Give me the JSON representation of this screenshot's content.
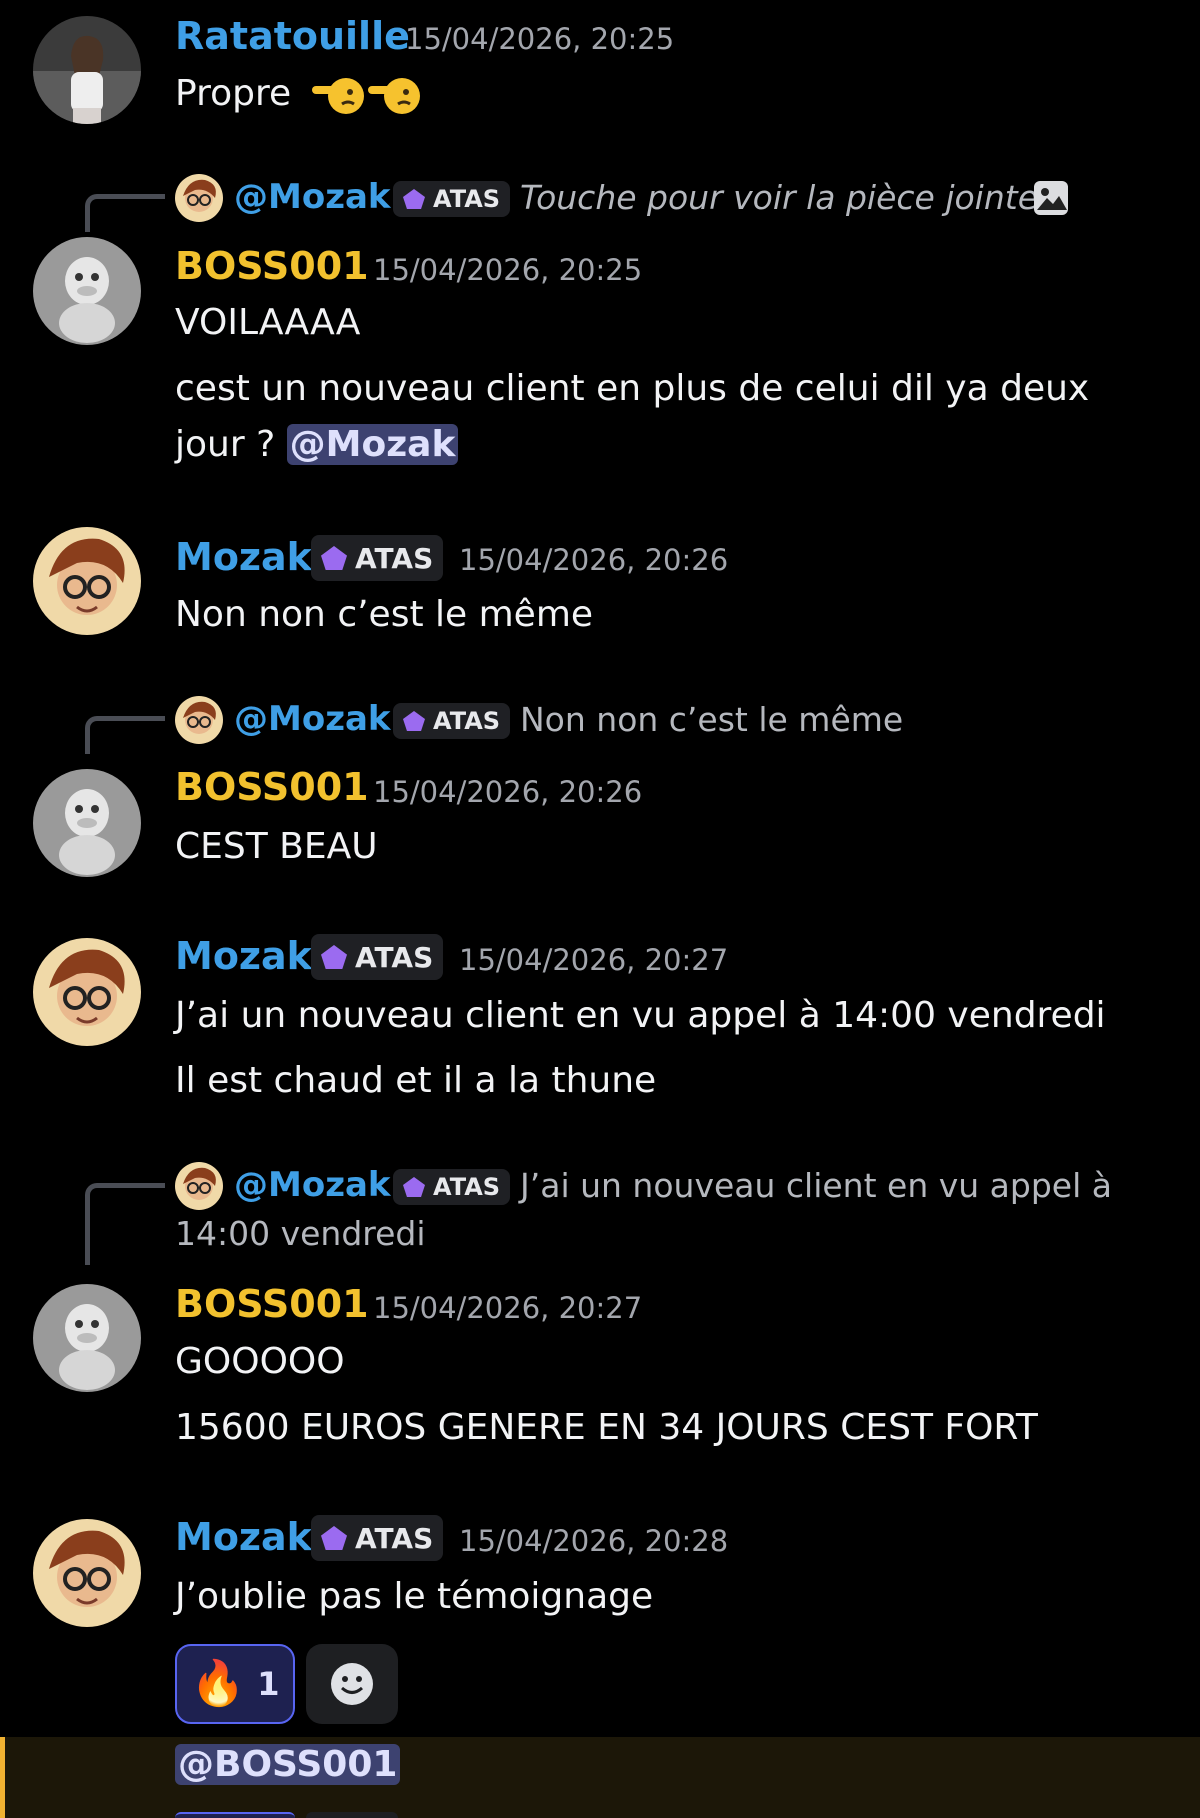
{
  "colors": {
    "background": "#000000",
    "username_blue": "#3f9fe6",
    "username_yellow": "#f2c12e",
    "timestamp": "#a3a6ad",
    "role_gem": "#9b6bf0",
    "mention_bg": "#3d4270",
    "highlight_bar": "#f0b232"
  },
  "messages": [
    {
      "author": "Ratatouille",
      "timestamp": "15/04/2026, 20:25",
      "lines": [
        "Propre"
      ],
      "emoji_icons": [
        "pointing-hand-emoji",
        "pointing-hand-emoji"
      ]
    },
    {
      "reply": {
        "name": "@Mozak",
        "role": "ATAS",
        "text": "Touche pour voir la pièce jointe",
        "icon": "image-icon"
      },
      "author": "BOSS001",
      "timestamp": "15/04/2026, 20:25",
      "lines": [
        "VOILAAAA",
        "cest un nouveau client en plus de celui dil ya deux",
        "jour ? "
      ],
      "mention": "@Mozak"
    },
    {
      "author": "Mozak",
      "role": "ATAS",
      "timestamp": "15/04/2026, 20:26",
      "lines": [
        "Non non c’est le même"
      ]
    },
    {
      "reply": {
        "name": "@Mozak",
        "role": "ATAS",
        "text": "Non non c’est le même"
      },
      "author": "BOSS001",
      "timestamp": "15/04/2026, 20:26",
      "lines": [
        "CEST BEAU"
      ]
    },
    {
      "author": "Mozak",
      "role": "ATAS",
      "timestamp": "15/04/2026, 20:27",
      "lines": [
        "J’ai un nouveau client en vu appel à 14:00 vendredi",
        "Il est chaud et il a la thune"
      ]
    },
    {
      "reply": {
        "name": "@Mozak",
        "role": "ATAS",
        "text": "J’ai un nouveau client en vu appel à",
        "text2": "14:00 vendredi"
      },
      "author": "BOSS001",
      "timestamp": "15/04/2026, 20:27",
      "lines": [
        "GOOOOO",
        "15600 EUROS GENERE EN 34 JOURS CEST FORT"
      ]
    },
    {
      "author": "Mozak",
      "role": "ATAS",
      "timestamp": "15/04/2026, 20:28",
      "lines": [
        "J’oublie pas le témoignage"
      ],
      "reactions": [
        {
          "emoji": "🔥",
          "icon": "fire-emoji",
          "count": "1"
        },
        {
          "icon": "add-reaction-icon"
        }
      ],
      "mention_line": "@BOSS001"
    }
  ]
}
